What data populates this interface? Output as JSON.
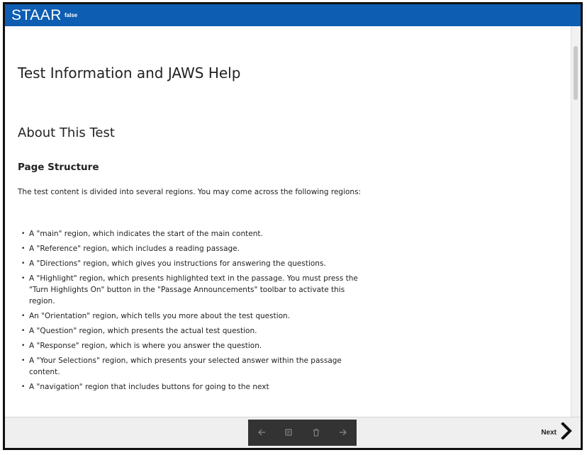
{
  "header": {
    "logo_text": "STAAR",
    "logo_sub": "false"
  },
  "main": {
    "title": "Test Information and JAWS Help",
    "section_title": "About This Test",
    "subsection_title": "Page Structure",
    "intro": "The test content is divided into several regions. You may come across the following regions:",
    "regions": [
      "A \"main\" region, which indicates the start of the main content.",
      "A \"Reference\" region, which includes a reading passage.",
      "A \"Directions\" region, which gives you instructions for answering the questions.",
      "A \"Highlight\" region, which presents highlighted text in the passage. You must press the \"Turn Highlights On\" button in the \"Passage Announcements\" toolbar to activate this region.",
      "An \"Orientation\" region, which tells you more about the test question.",
      "A \"Question\" region, which presents the actual test question.",
      "A \"Response\" region, which is where you answer the question.",
      "A \"Your Selections\" region, which presents your selected answer within the passage content.",
      "A \"navigation\" region that includes buttons for going to the next"
    ]
  },
  "footer": {
    "nav_icons": [
      "arrow-left-icon",
      "note-icon",
      "trash-icon",
      "arrow-right-icon"
    ],
    "next_label": "Next"
  },
  "colors": {
    "topbar": "#0d5db2",
    "nav_group": "#333333",
    "bottom_bar": "#efefef"
  }
}
